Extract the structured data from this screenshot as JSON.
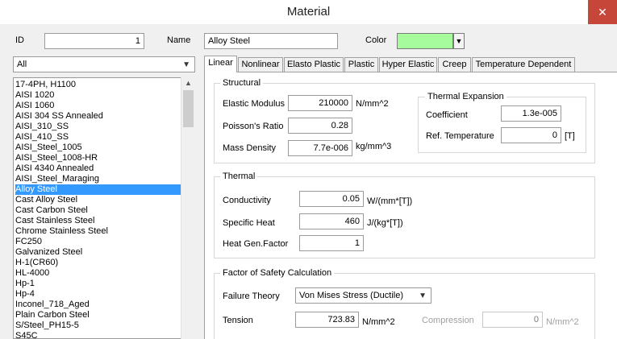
{
  "window": {
    "title": "Material",
    "close_glyph": "✕"
  },
  "header": {
    "id_label": "ID",
    "id_value": "1",
    "name_label": "Name",
    "name_value": "Alloy Steel",
    "color_label": "Color",
    "color_hex": "#a6fb9c",
    "color_arrow": "▼"
  },
  "filter": {
    "value": "All",
    "arrow": "▼"
  },
  "materials": {
    "selected_index": 16,
    "items": [
      "17-4PH, H1100",
      "AISI 1020",
      "AISI 1060",
      "AISI 304 SS Annealed",
      "AISI_310_SS",
      "AISI_410_SS",
      "AISI_Steel_1005",
      "AISI_Steel_1008-HR",
      "AISI 4340 Annealed",
      "AISI_Steel_Maraging",
      "Alloy Steel",
      "Cast Alloy Steel",
      "Cast Carbon Steel",
      "Cast Stainless Steel",
      "Chrome Stainless Steel",
      "FC250",
      "Galvanized Steel",
      "H-1(CR60)",
      "HL-4000",
      "Hp-1",
      "Hp-4",
      "Inconel_718_Aged",
      "Plain Carbon Steel",
      "S/Steel_PH15-5",
      "S45C"
    ]
  },
  "tabs": [
    "Linear",
    "Nonlinear",
    "Elasto Plastic",
    "Plastic",
    "Hyper Elastic",
    "Creep",
    "Temperature Dependent"
  ],
  "structural": {
    "title": "Structural",
    "elastic_modulus_label": "Elastic Modulus",
    "elastic_modulus_value": "210000",
    "elastic_modulus_unit": "N/mm^2",
    "poisson_label": "Poisson's Ratio",
    "poisson_value": "0.28",
    "density_label": "Mass Density",
    "density_value": "7.7e-006",
    "density_unit": "kg/mm^3"
  },
  "thermal_expansion": {
    "title": "Thermal Expansion",
    "coefficient_label": "Coefficient",
    "coefficient_value": "1.3e-005",
    "ref_temp_label": "Ref. Temperature",
    "ref_temp_value": "0",
    "ref_temp_unit": "[T]"
  },
  "thermal": {
    "title": "Thermal",
    "conductivity_label": "Conductivity",
    "conductivity_value": "0.05",
    "conductivity_unit": "W/(mm*[T])",
    "specific_heat_label": "Specific Heat",
    "specific_heat_value": "460",
    "specific_heat_unit": "J/(kg*[T])",
    "heat_gen_label": "Heat Gen.Factor",
    "heat_gen_value": "1"
  },
  "safety": {
    "title": "Factor of Safety Calculation",
    "failure_theory_label": "Failure Theory",
    "failure_theory_value": "Von Mises Stress (Ductile)",
    "failure_theory_arrow": "▼",
    "tension_label": "Tension",
    "tension_value": "723.83",
    "tension_unit": "N/mm^2",
    "compression_label": "Compression",
    "compression_value": "0",
    "compression_unit": "N/mm^2"
  }
}
